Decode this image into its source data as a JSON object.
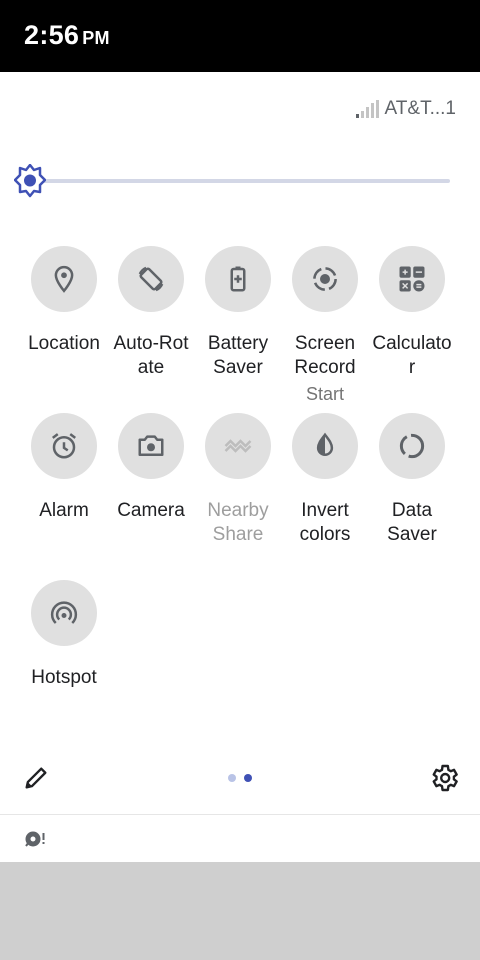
{
  "status_bar": {
    "time": "2:56",
    "ampm": "PM"
  },
  "carrier": {
    "name": "AT&T...1"
  },
  "brightness": {
    "level": 0
  },
  "tiles": [
    {
      "label": "Location",
      "icon": "location-pin-icon"
    },
    {
      "label": "Auto-Rot ate",
      "icon": "auto-rotate-icon"
    },
    {
      "label": "Battery Saver",
      "icon": "battery-saver-icon"
    },
    {
      "label": "Screen Record",
      "sublabel": "Start",
      "icon": "screen-record-icon"
    },
    {
      "label": "Calculato r",
      "icon": "calculator-icon"
    },
    {
      "label": "Alarm",
      "icon": "alarm-icon"
    },
    {
      "label": "Camera",
      "icon": "camera-icon"
    },
    {
      "label": "Nearby Share",
      "icon": "nearby-share-icon",
      "disabled": true
    },
    {
      "label": "Invert colors",
      "icon": "invert-colors-icon"
    },
    {
      "label": "Data Saver",
      "icon": "data-saver-icon"
    },
    {
      "label": "Hotspot",
      "icon": "hotspot-icon"
    }
  ],
  "pager": {
    "pages": 2,
    "current": 2
  },
  "colors": {
    "accent": "#3f51b5",
    "tile_bg": "#e0e0e0",
    "status_bar_bg": "#000000",
    "scrim": "#cfcfcf"
  }
}
